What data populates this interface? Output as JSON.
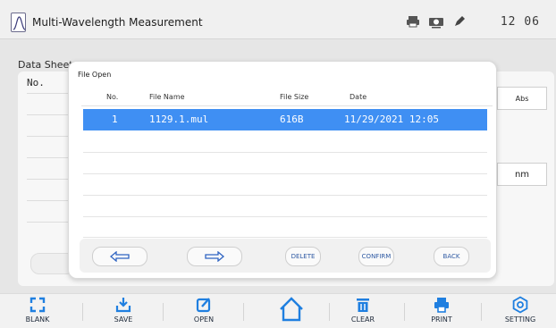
{
  "app": {
    "title": "Multi-Wavelength Measurement",
    "clock": "12 06"
  },
  "sheet": {
    "title": "Data Sheet",
    "no_label": "No.",
    "right_abs": "Abs",
    "right_nm": "nm"
  },
  "dialog": {
    "title": "File Open",
    "columns": [
      "No.",
      "File Name",
      "File Size",
      "Date"
    ],
    "rows": [
      {
        "no": "1",
        "name": "1129.1.mul",
        "size": "616B",
        "date": "11/29/2021 12:05",
        "selected": true
      }
    ],
    "buttons": {
      "prev": "prev-arrow",
      "next": "next-arrow",
      "delete": "DELETE",
      "confirm": "CONFIRM",
      "back": "BACK"
    }
  },
  "toolbar": [
    {
      "label": "BLANK",
      "icon": "blank-icon"
    },
    {
      "label": "SAVE",
      "icon": "save-icon"
    },
    {
      "label": "OPEN",
      "icon": "open-icon"
    },
    {
      "label": "",
      "icon": "home-icon"
    },
    {
      "label": "CLEAR",
      "icon": "trash-icon"
    },
    {
      "label": "PRINT",
      "icon": "printer-icon"
    },
    {
      "label": "SETTING",
      "icon": "settings-icon"
    }
  ],
  "colors": {
    "accent": "#3f8ff3",
    "icon_blue": "#1f7fe0"
  }
}
